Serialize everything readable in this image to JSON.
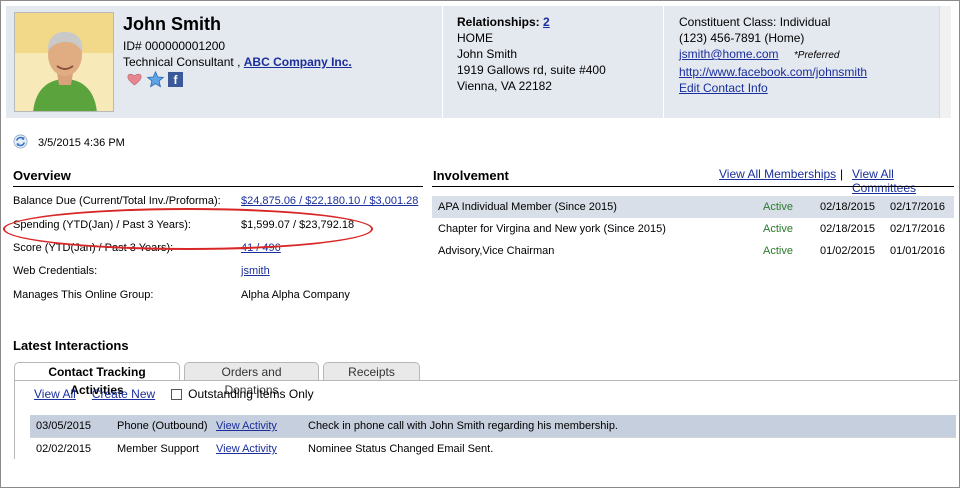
{
  "header": {
    "name": "John Smith",
    "id_line": "ID# 000000001200",
    "title": "Technical Consultant ,",
    "company": "ABC Company Inc.",
    "relationships_label": "Relationships:",
    "relationships_count": "2",
    "address_lines": [
      "HOME",
      "John Smith",
      "1919 Gallows rd, suite #400",
      "Vienna, VA 22182"
    ],
    "constituent_class": "Constituent Class: Individual",
    "phone": "(123) 456-7891 (Home)",
    "email": "jsmith@home.com",
    "email_note": "*Preferred",
    "website": "http://www.facebook.com/johnsmith",
    "edit_link": "Edit Contact Info"
  },
  "refresh": {
    "timestamp": "3/5/2015 4:36 PM"
  },
  "overview": {
    "title": "Overview",
    "rows": [
      {
        "label": "Balance Due (Current/Total Inv./Proforma):",
        "value": "$24,875.06 / $22,180.10 / $3,001.28",
        "link": true
      },
      {
        "label": "Spending (YTD(Jan) / Past 3 Years):",
        "value": "$1,599.07 / $23,792.18",
        "link": false
      },
      {
        "label": "Score (YTD(Jan) / Past 3 Years):",
        "value": "41 / 496",
        "link": true
      },
      {
        "label": "Web Credentials:",
        "value": "jsmith",
        "link": true
      },
      {
        "label": "Manages This Online Group:",
        "value": "Alpha Alpha Company",
        "link": false
      }
    ]
  },
  "involvement": {
    "title": "Involvement",
    "view_memberships": "View All Memberships",
    "separator": "|",
    "view_committees": "View All Committees",
    "rows": [
      {
        "name": "APA Individual Member (Since 2015)",
        "status": "Active",
        "start": "02/18/2015",
        "end": "02/17/2016"
      },
      {
        "name": "Chapter for Virgina and New york (Since 2015)",
        "status": "Active",
        "start": "02/18/2015",
        "end": "02/17/2016"
      },
      {
        "name": "Advisory,Vice Chairman",
        "status": "Active",
        "start": "01/02/2015",
        "end": "01/01/2016"
      }
    ]
  },
  "interactions": {
    "title": "Latest Interactions",
    "tabs": [
      "Contact Tracking Activities",
      "Orders and Donations",
      "Receipts"
    ],
    "view_all": "View All",
    "create_new": "Create New",
    "outstanding_label": "Outstanding Items Only",
    "rows": [
      {
        "date": "03/05/2015",
        "type": "Phone (Outbound)",
        "link": "View Activity",
        "note": "Check in phone call with John Smith regarding his membership."
      },
      {
        "date": "02/02/2015",
        "type": "Member Support",
        "link": "View Activity",
        "note": "Nominee Status Changed Email Sent."
      }
    ]
  },
  "colors": {
    "header_bg": "#e4e8ef",
    "link": "#1a2e9c",
    "active": "#2a7a2a",
    "highlight": "#d92626"
  },
  "icons": [
    "person-photo",
    "heart-icon",
    "star-icon",
    "facebook-icon",
    "refresh-icon",
    "checkbox-icon"
  ]
}
